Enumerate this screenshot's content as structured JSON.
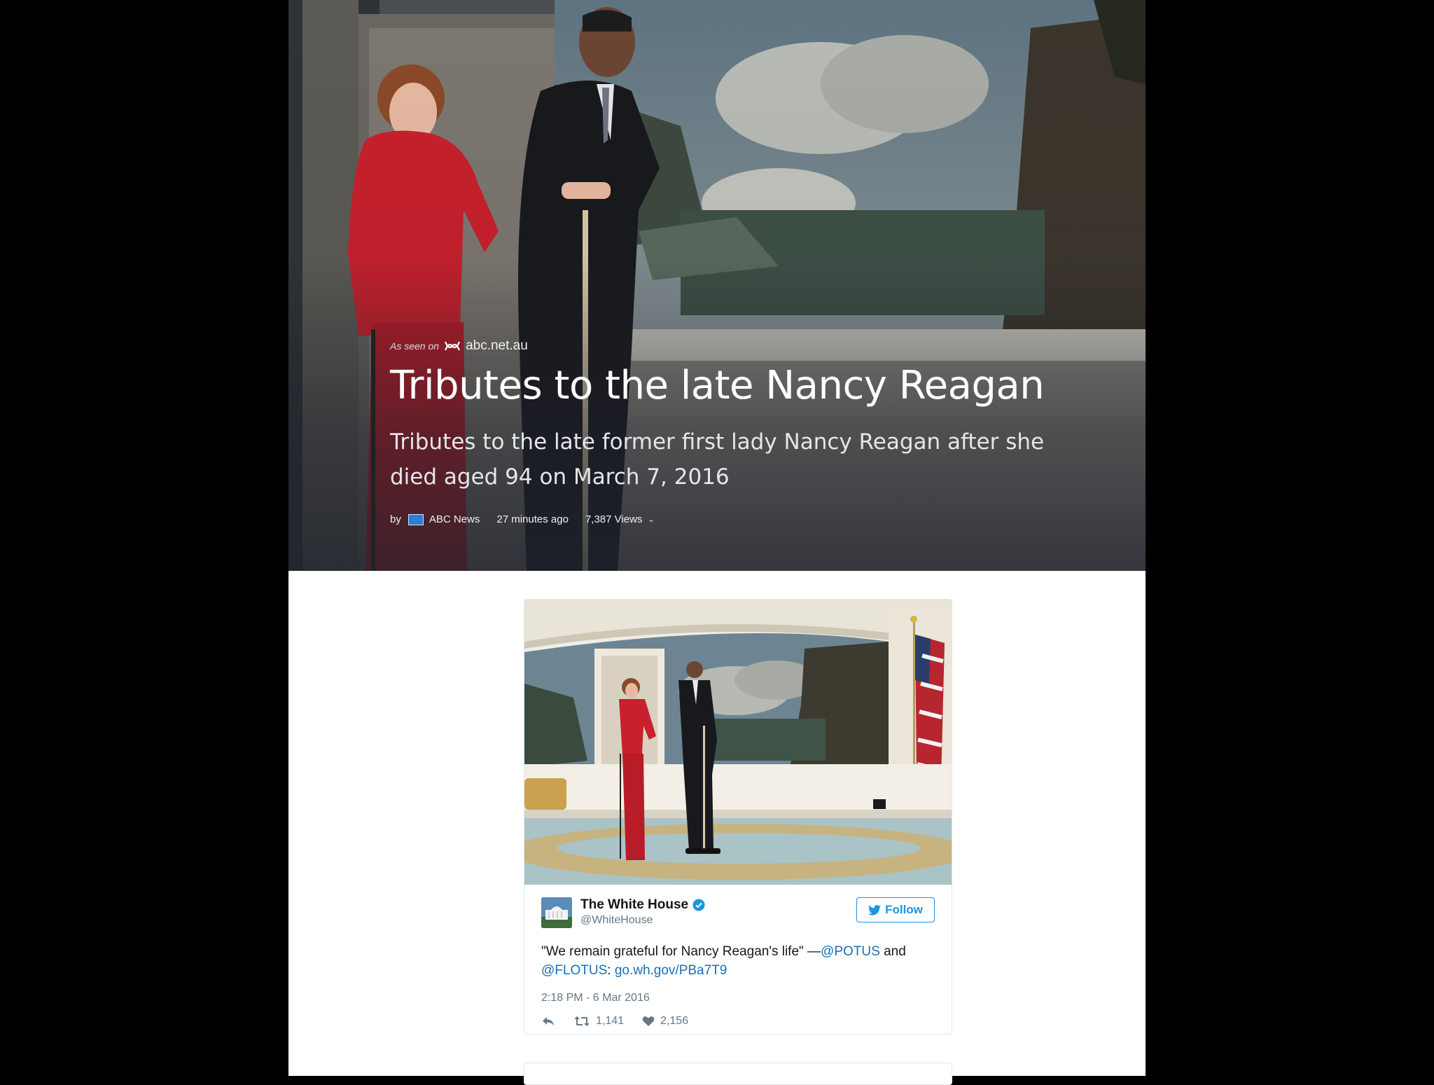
{
  "hero": {
    "as_seen_on": "As seen on",
    "source_site": "abc.net.au",
    "title": "Tributes to the late Nancy Reagan",
    "subtitle": "Tributes to the late former first lady Nancy Reagan after she died aged 94 on March 7, 2016",
    "meta": {
      "by": "by",
      "author": "ABC News",
      "time_ago": "27 minutes ago",
      "views": "7,387 Views"
    }
  },
  "tweet": {
    "author_name": "The White House",
    "handle": "@WhiteHouse",
    "follow_label": "Follow",
    "text_before": "\"We remain grateful for Nancy Reagan's life\" —",
    "mention_potus": "@POTUS",
    "text_and": " and ",
    "mention_flotus": "@FLOTUS",
    "text_colon": ": ",
    "link": "go.wh.gov/PBa7T9",
    "timestamp": "2:18 PM - 6 Mar 2016",
    "retweets": "1,141",
    "likes": "2,156"
  },
  "colors": {
    "twitter_blue": "#1b95e0",
    "link_blue": "#1b6fb4",
    "red_suit": "#c8202c",
    "text_dark": "#14171a",
    "text_muted": "#657786"
  },
  "icons": [
    "abc-logo-icon",
    "abc-news-icon",
    "chevron-down-icon",
    "verified-badge-icon",
    "twitter-bird-icon",
    "reply-icon",
    "retweet-icon",
    "heart-icon"
  ]
}
